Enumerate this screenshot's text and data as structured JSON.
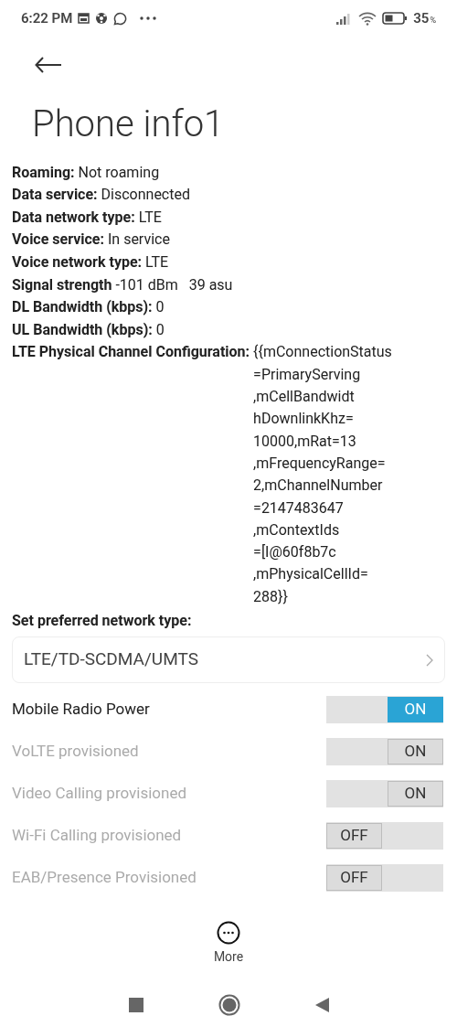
{
  "status_bar": {
    "time": "6:22 PM",
    "battery": "35",
    "battery_unit": "%"
  },
  "title": "Phone info1",
  "info_rows": [
    {
      "label": "Roaming:",
      "value": "Not roaming"
    },
    {
      "label": "Data service:",
      "value": "Disconnected"
    },
    {
      "label": "Data network type:",
      "value": "LTE"
    },
    {
      "label": "Voice service:",
      "value": "In service"
    },
    {
      "label": "Voice network type:",
      "value": "LTE"
    },
    {
      "label": "Signal strength",
      "value": "-101 dBm   39 asu"
    },
    {
      "label": "DL Bandwidth (kbps):",
      "value": "0"
    },
    {
      "label": "UL Bandwidth (kbps):",
      "value": "0"
    }
  ],
  "channel_config": {
    "label": "LTE Physical Channel Configuration:",
    "value_lines": [
      "{{mConnectionStatus",
      "=PrimaryServing",
      ",mCellBandwidt",
      "hDownlinkKhz=",
      "10000,mRat=13",
      ",mFrequencyRange=",
      "2,mChannelNumber",
      "=2147483647",
      ",mContextIds",
      "=[I@60f8b7c",
      ",mPhysicalCellId=",
      "288}}"
    ]
  },
  "network_type": {
    "label": "Set preferred network type:",
    "value": "LTE/TD-SCDMA/UMTS"
  },
  "toggles": [
    {
      "label": "Mobile Radio Power",
      "on": true,
      "disabled": false,
      "text": "ON"
    },
    {
      "label": "VoLTE provisioned",
      "on": true,
      "disabled": true,
      "text": "ON"
    },
    {
      "label": "Video Calling provisioned",
      "on": true,
      "disabled": true,
      "text": "ON"
    },
    {
      "label": "Wi-Fi Calling provisioned",
      "on": false,
      "disabled": true,
      "text": "OFF"
    },
    {
      "label": "EAB/Presence Provisioned",
      "on": false,
      "disabled": true,
      "text": "OFF"
    }
  ],
  "more": {
    "label": "More"
  }
}
